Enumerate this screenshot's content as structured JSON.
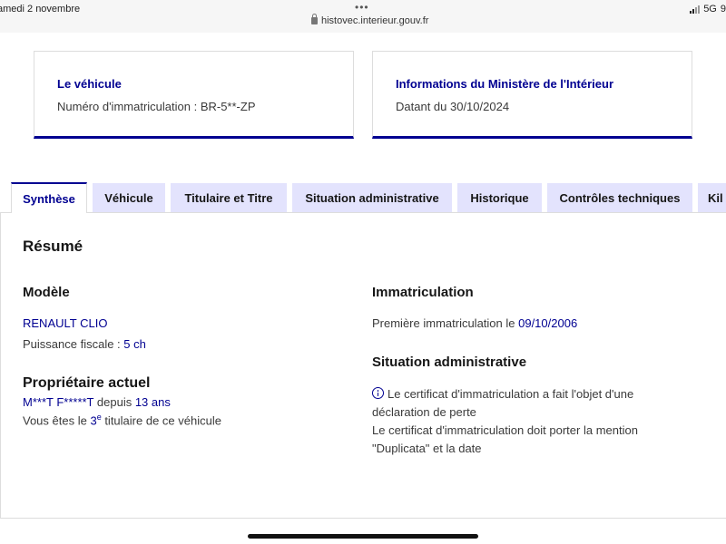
{
  "status_bar": {
    "date": "amedi 2 novembre",
    "dots": "•••",
    "url": "histovec.interieur.gouv.fr",
    "network": "5G",
    "battery_partial": "9"
  },
  "card_vehicle": {
    "title": "Le véhicule",
    "plate_label": "Numéro d'immatriculation : ",
    "plate_value": "BR-5**-ZP"
  },
  "card_ministry": {
    "title": "Informations du Ministère de l'Intérieur",
    "date_text": "Datant du 30/10/2024"
  },
  "tabs": [
    {
      "label": "Synthèse",
      "active": true
    },
    {
      "label": "Véhicule"
    },
    {
      "label": "Titulaire et Titre"
    },
    {
      "label": "Situation administrative"
    },
    {
      "label": "Historique"
    },
    {
      "label": "Contrôles techniques"
    },
    {
      "label": "Kil"
    }
  ],
  "summary": {
    "heading": "Résumé",
    "model": {
      "heading": "Modèle",
      "name": "RENAULT CLIO",
      "power_label": "Puissance fiscale : ",
      "power_value": "5 ch"
    },
    "owner": {
      "heading": "Propriétaire actuel",
      "name": "M***T F*****T",
      "since_label": " depuis ",
      "since_value": "13 ans",
      "rank_prefix": "Vous êtes le ",
      "rank_number": "3",
      "rank_sup": "e",
      "rank_suffix": " titulaire de ce véhicule"
    },
    "registration": {
      "heading": "Immatriculation",
      "first_label": "Première immatriculation le ",
      "first_date": "09/10/2006"
    },
    "admin": {
      "heading": "Situation administrative",
      "line1": "Le certificat d'immatriculation a fait l'objet d'une",
      "line2": "déclaration de perte",
      "line3": "Le certificat d'immatriculation doit porter la mention",
      "line4": "\"Duplicata\" et la date"
    }
  }
}
